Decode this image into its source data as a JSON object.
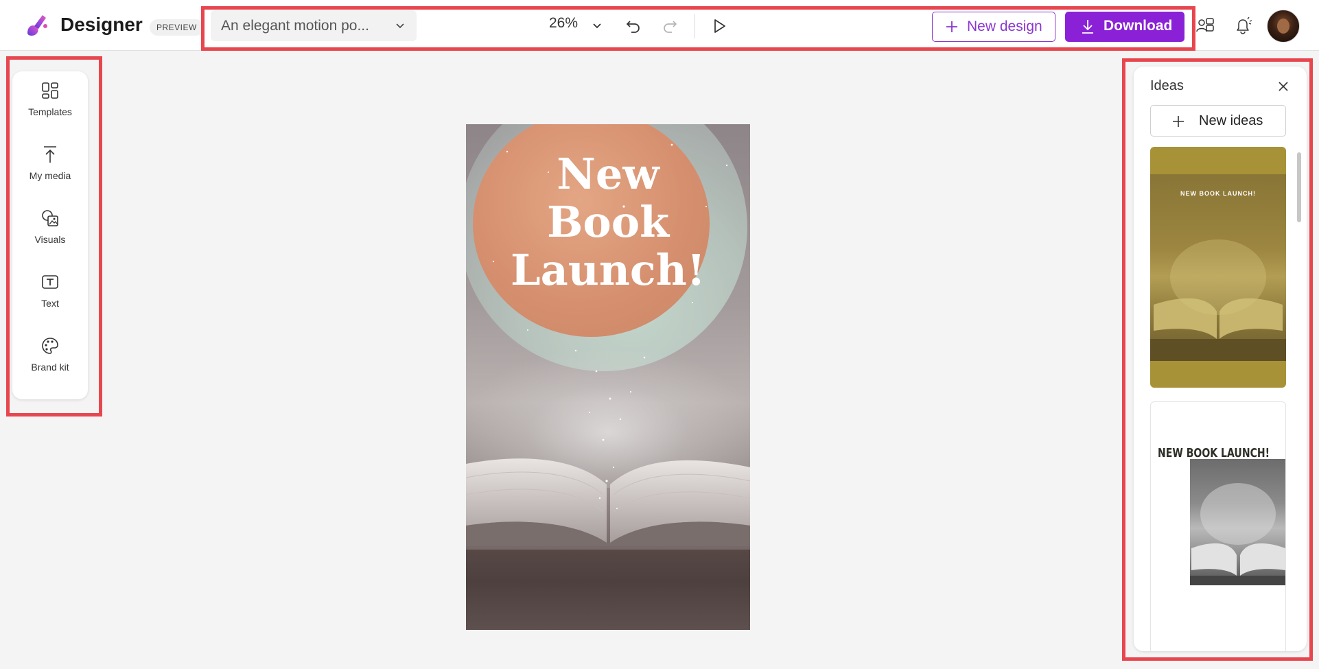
{
  "app": {
    "name": "Designer",
    "badge": "PREVIEW"
  },
  "header": {
    "design_title": "An elegant motion po...",
    "zoom": "26%",
    "new_design_label": "New design",
    "download_label": "Download",
    "accent_color": "#8a21d6"
  },
  "sidebar": {
    "items": [
      {
        "label": "Templates",
        "icon": "templates-icon"
      },
      {
        "label": "My media",
        "icon": "upload-icon"
      },
      {
        "label": "Visuals",
        "icon": "visuals-icon"
      },
      {
        "label": "Text",
        "icon": "text-icon"
      },
      {
        "label": "Brand kit",
        "icon": "palette-icon"
      }
    ]
  },
  "canvas": {
    "headline_line1": "New",
    "headline_line2": "Book",
    "headline_line3": "Launch!"
  },
  "ideas": {
    "title": "Ideas",
    "new_ideas_label": "New ideas",
    "cards": [
      {
        "caption": "NEW BOOK LAUNCH!",
        "color": "#a89237"
      },
      {
        "caption": "NEW BOOK LAUNCH!",
        "color": "#ffffff"
      }
    ]
  }
}
